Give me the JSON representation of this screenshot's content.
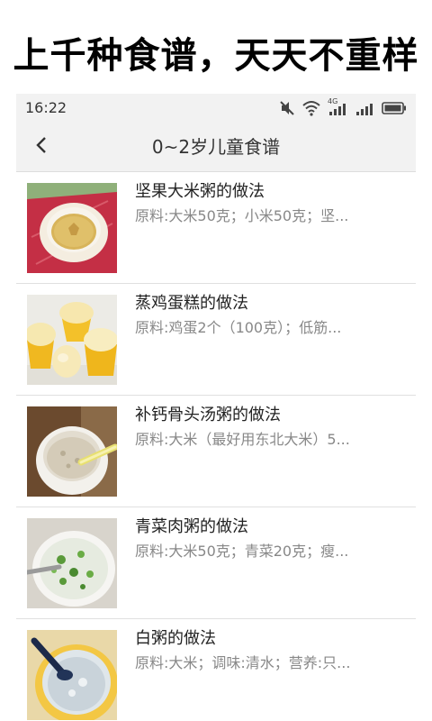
{
  "promo": {
    "title": "上千种食谱，天天不重样"
  },
  "status_bar": {
    "time": "16:22",
    "icons": [
      "mute-icon",
      "wifi-icon",
      "signal-4g-icon",
      "signal-icon",
      "battery-icon"
    ],
    "network_label": "4G"
  },
  "nav": {
    "back_icon": "chevron-left-icon",
    "title": "0~2岁儿童食谱"
  },
  "recipes": [
    {
      "title": "坚果大米粥的做法",
      "desc": "原料:大米50克；小米50克；坚...",
      "thumb": "nut-rice-porridge"
    },
    {
      "title": "蒸鸡蛋糕的做法",
      "desc": "原料:鸡蛋2个（100克）；低筋...",
      "thumb": "steamed-egg-cake"
    },
    {
      "title": "补钙骨头汤粥的做法",
      "desc": "原料:大米（最好用东北大米）5...",
      "thumb": "bone-soup-porridge"
    },
    {
      "title": "青菜肉粥的做法",
      "desc": "原料:大米50克；青菜20克；瘦...",
      "thumb": "vegetable-meat-porridge"
    },
    {
      "title": "白粥的做法",
      "desc": "原料:大米；调味:清水；营养:只...",
      "thumb": "plain-rice-porridge"
    }
  ],
  "colors": {
    "header_bg": "#f2f2f2",
    "title_text": "#222222",
    "desc_text": "#888888",
    "divider": "#e0e0e0"
  }
}
